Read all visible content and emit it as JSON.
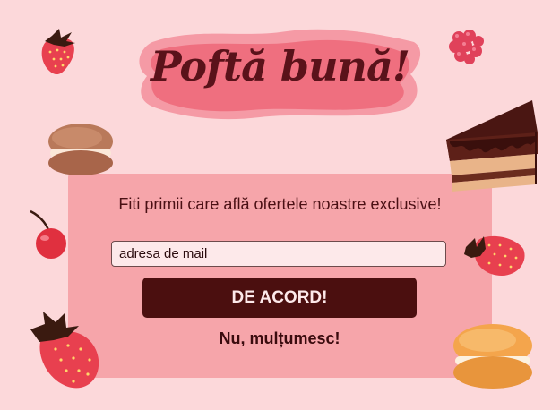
{
  "popup": {
    "title": "Poftă bună!",
    "subtitle": "Fiti primii care află ofertele noastre exclusive!",
    "email_placeholder": "adresa de mail",
    "accept_label": "DE ACORD!",
    "decline_label": "Nu, mulțumesc!"
  },
  "colors": {
    "background": "#fcd8da",
    "card": "#f6a2a8",
    "title_blob": "#ef6f7f",
    "accept_button": "#4b0f0f",
    "text_dark": "#4a1014"
  },
  "decorations": [
    "strawberry-icon",
    "raspberry-icon",
    "macaron-icon",
    "cake-slice-icon",
    "cherry-icon",
    "strawberry-icon",
    "strawberry-icon",
    "macaron-icon"
  ]
}
